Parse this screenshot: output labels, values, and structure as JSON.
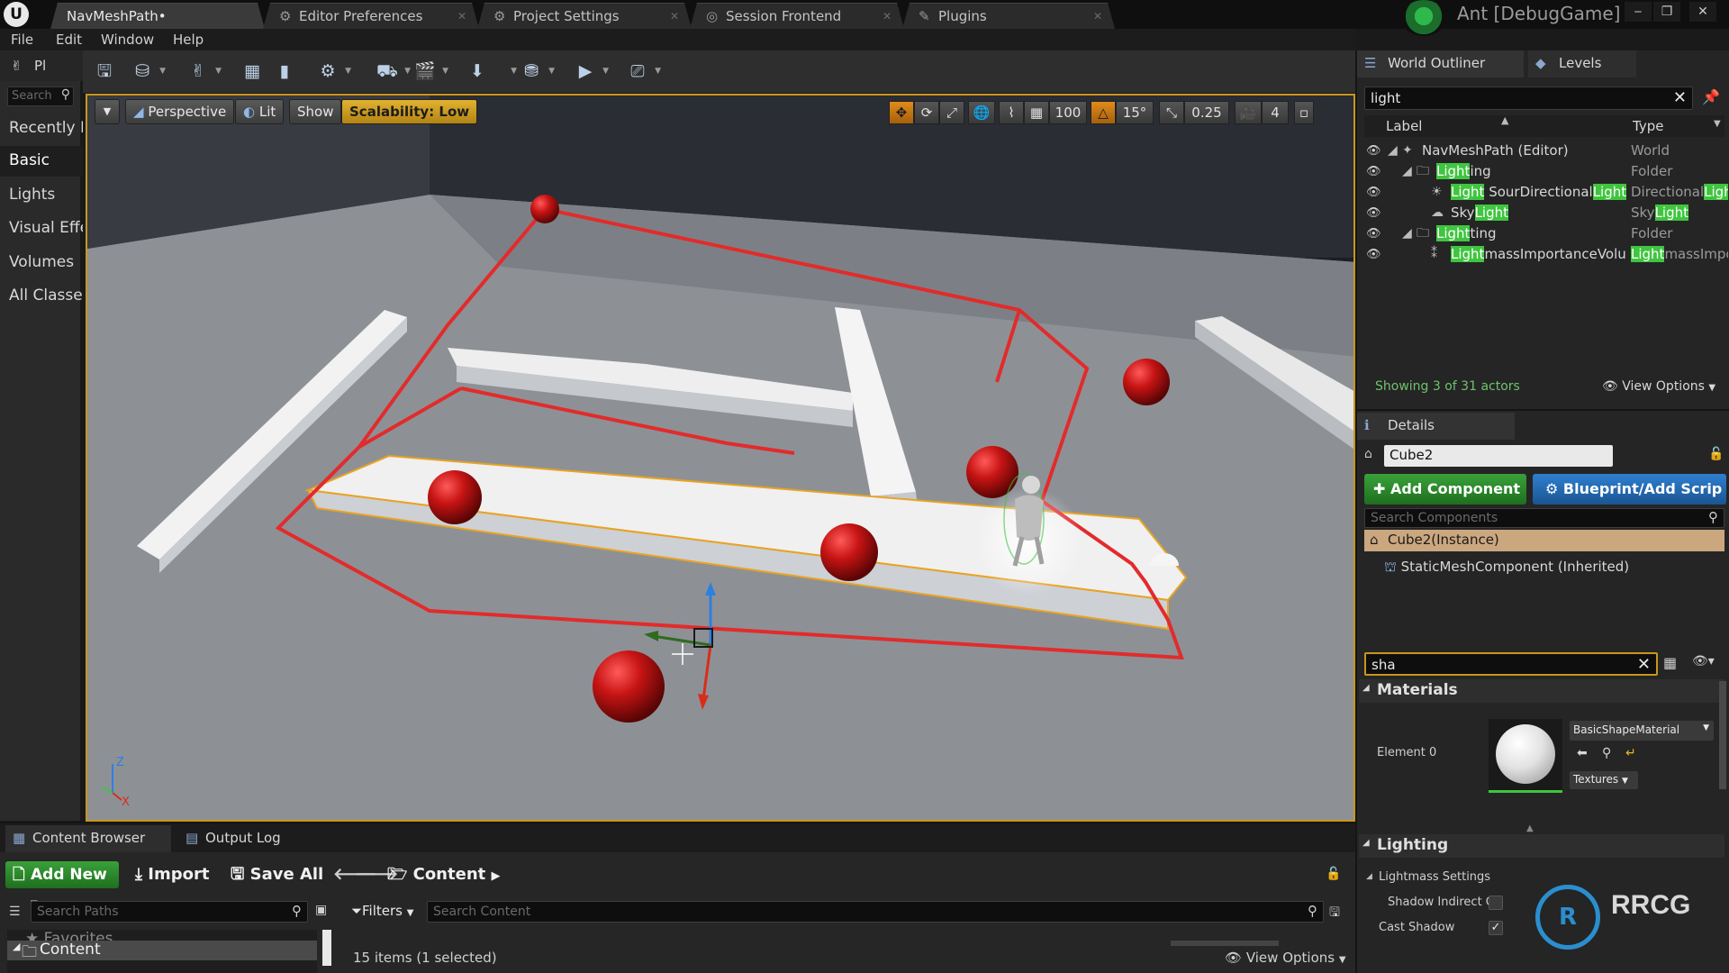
{
  "window": {
    "tabs": [
      {
        "label": "NavMeshPath•"
      },
      {
        "label": "Editor Preferences"
      },
      {
        "label": "Project Settings"
      },
      {
        "label": "Session Frontend"
      },
      {
        "label": "Plugins"
      }
    ],
    "build_name": "Ant [DebugGame]",
    "watermark": "RRCG"
  },
  "menu": [
    "File",
    "Edit",
    "Window",
    "Help"
  ],
  "modes": {
    "place_label": "Pl",
    "search_placeholder": "Search",
    "categories": [
      "Recently P",
      "Basic",
      "Lights",
      "Visual Effe",
      "Volumes",
      "All Classe"
    ]
  },
  "viewport": {
    "view_mode": "Perspective",
    "lighting_mode": "Lit",
    "show_label": "Show",
    "scalability": "Scalability: Low",
    "grid_snap": "100",
    "rotation_snap": "15°",
    "scale_snap": "0.25",
    "camera_speed": "4",
    "axis_labels": {
      "z": "Z",
      "x": "X"
    }
  },
  "outliner": {
    "tab_label": "World Outliner",
    "levels_tab": "Levels",
    "search_value": "light",
    "col_label": "Label",
    "col_type": "Type",
    "rows": [
      {
        "pre": "NavMeshPath (Editor)",
        "hl": "",
        "post": "",
        "type_pre": "World",
        "type_hl": "",
        "type_post": ""
      },
      {
        "pre": "",
        "hl": "Light",
        "post": "ing",
        "type_pre": "Folder",
        "type_hl": "",
        "type_post": ""
      },
      {
        "pre": "",
        "hl": "Light",
        "post": " SourDirectional",
        "hl2": "Light",
        "type_pre": "Directional",
        "type_hl": "Light",
        "type_post": ""
      },
      {
        "pre": "Sky",
        "hl": "Light",
        "post": "",
        "type_pre": "Sky",
        "type_hl": "Light",
        "type_post": ""
      },
      {
        "pre": "",
        "hl": "Light",
        "post": "ting",
        "type_pre": "Folder",
        "type_hl": "",
        "type_post": ""
      },
      {
        "pre": "",
        "hl": "Light",
        "post": "massImportanceVolun",
        "type_pre": "",
        "type_hl": "Light",
        "type_post": "massImpo"
      }
    ],
    "row_extra_sky_type": "SkyLight",
    "status": "Showing 3 of 31 actors",
    "view_options": "View Options"
  },
  "details": {
    "tab_label": "Details",
    "actor_name": "Cube2",
    "add_component": "Add Component",
    "blueprint_btn": "Blueprint/Add Scrip",
    "search_components_placeholder": "Search Components",
    "instance_label": "Cube2(Instance)",
    "component_label": "StaticMeshComponent (Inherited)",
    "filter_value": "sha",
    "materials_title": "Materials",
    "element_label": "Element 0",
    "material_name": "BasicShapeMaterial",
    "textures_label": "Textures",
    "lighting_title": "Lighting",
    "lightmass_label": "Lightmass Settings",
    "shadow_indirect": "Shadow Indirect C",
    "cast_shadow": "Cast Shadow",
    "cast_shadow_checked": true
  },
  "content_browser": {
    "tab_label": "Content Browser",
    "output_log_tab": "Output Log",
    "add_new": "Add New",
    "import": "Import",
    "save_all": "Save All",
    "path_root": "Content",
    "search_paths_placeholder": "Search Paths",
    "filters": "Filters",
    "search_content_placeholder": "Search Content",
    "favorites": "Favorites",
    "tree_root": "Content",
    "status": "15 items (1 selected)",
    "view_options": "View Options"
  },
  "colors": {
    "accent_orange": "#c8961e",
    "highlight_green": "#3fc53f",
    "path_red": "#e22b2b",
    "sphere_red": "#c81414"
  }
}
